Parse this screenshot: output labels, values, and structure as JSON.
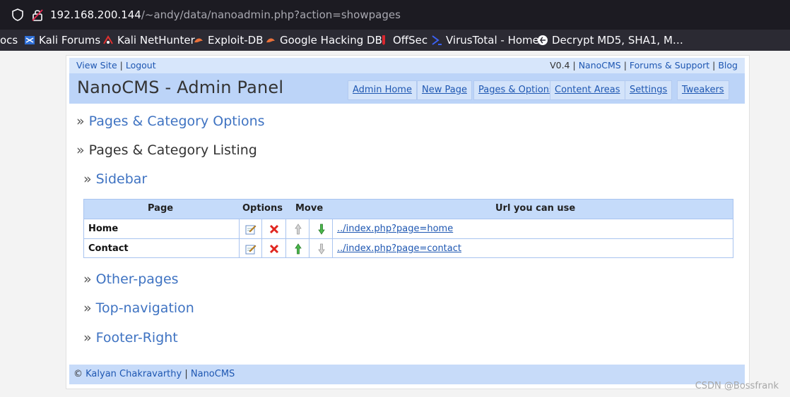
{
  "browser": {
    "url_host": "192.168.200.144",
    "url_path": "/~andy/data/nanoadmin.php?action=showpages",
    "bookmarks": [
      {
        "label": "ocs",
        "icon": "docs-icon"
      },
      {
        "label": "Kali Forums",
        "icon": "kali-forums-icon"
      },
      {
        "label": "Kali NetHunter",
        "icon": "kali-nethunter-icon"
      },
      {
        "label": "Exploit-DB",
        "icon": "exploit-db-icon"
      },
      {
        "label": "Google Hacking DB",
        "icon": "ghdb-icon"
      },
      {
        "label": "OffSec",
        "icon": "offsec-icon"
      },
      {
        "label": "VirusTotal - Home",
        "icon": "virustotal-icon"
      },
      {
        "label": "Decrypt MD5, SHA1, M…",
        "icon": "decrypt-icon"
      }
    ]
  },
  "topbar": {
    "view_site": "View Site",
    "logout": "Logout",
    "version": "V0.4",
    "nanocms": "NanoCMS",
    "forums": "Forums & Support",
    "blog": "Blog",
    "sep": "|"
  },
  "header": {
    "title": "NanoCMS - Admin Panel",
    "nav": [
      "Admin Home",
      "New Page",
      "Pages & Options",
      "Content Areas",
      "Settings",
      "Tweakers"
    ]
  },
  "sections": {
    "raquo": "»",
    "options": "Pages & Category Options",
    "listing": "Pages & Category Listing",
    "sidebar": "Sidebar",
    "other": "Other-pages",
    "topnav": "Top-navigation",
    "footer_right": "Footer-Right"
  },
  "table": {
    "headers": [
      "Page",
      "Options",
      "Move",
      "Url you can use"
    ],
    "rows": [
      {
        "page": "Home",
        "url": "../index.php?page=home"
      },
      {
        "page": "Contact",
        "url": "../index.php?page=contact"
      }
    ]
  },
  "footer": {
    "copy": "©",
    "author": "Kalyan Chakravarthy",
    "sep": "|",
    "nanocms": "NanoCMS"
  },
  "watermark": "CSDN @Bossfrank",
  "colors": {
    "link": "#1e57b2",
    "header_bg": "#bcd4f8",
    "table_head_bg": "#c5dbfa"
  }
}
